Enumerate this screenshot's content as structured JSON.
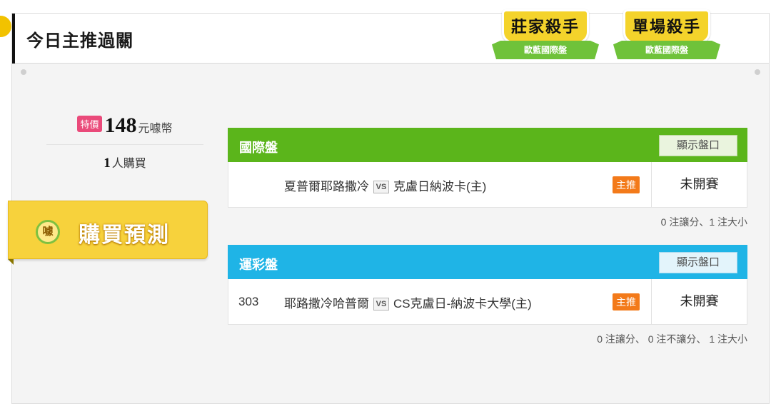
{
  "header": {
    "title": "今日主推過關"
  },
  "ribbons": [
    {
      "title": "莊家殺手",
      "subtitle": "歐藍國際盤"
    },
    {
      "title": "單場殺手",
      "subtitle": "歐藍國際盤"
    }
  ],
  "pricing": {
    "badge": "特價",
    "price": "148",
    "unit": "元噱幣",
    "buyers_count": "1",
    "buyers_label": "人購買"
  },
  "buy_button": {
    "coin_text": "噱",
    "label": "購買預測"
  },
  "markets": [
    {
      "title": "國際盤",
      "color": "#5bb51b",
      "show_button": "顯示盤口",
      "row": {
        "id": "",
        "away_team": "夏普爾耶路撒冷",
        "vs": "VS",
        "home_team": "克盧日納波卡(主)",
        "badge": "主推",
        "status": "未開賽"
      },
      "summary": "0 注讓分、1 注大小"
    },
    {
      "title": "運彩盤",
      "color": "#1fb4e6",
      "show_button": "顯示盤口",
      "row": {
        "id": "303",
        "away_team": "耶路撒冷哈普爾",
        "vs": "VS",
        "home_team": "CS克盧日-納波卡大學(主)",
        "badge": "主推",
        "status": "未開賽"
      },
      "summary": "0 注讓分、 0 注不讓分、 1 注大小"
    }
  ]
}
